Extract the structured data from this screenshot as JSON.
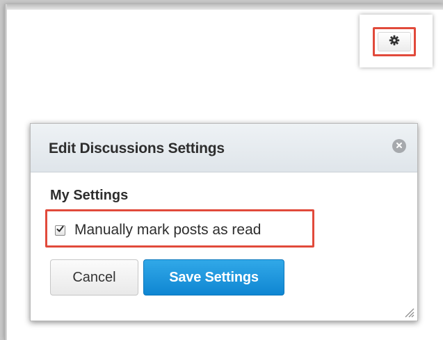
{
  "gear_button": {
    "icon": "gear-icon",
    "highlight_color": "#e14a3b"
  },
  "dialog": {
    "title": "Edit Discussions Settings",
    "close_icon": "close-icon",
    "section_heading": "My Settings",
    "options": [
      {
        "label": "Manually mark posts as read",
        "checked": true
      }
    ],
    "buttons": {
      "cancel_label": "Cancel",
      "save_label": "Save Settings"
    }
  },
  "colors": {
    "highlight": "#e14a3b",
    "primary_button": "#1a95dc",
    "header_bg": "#e6ebef"
  }
}
